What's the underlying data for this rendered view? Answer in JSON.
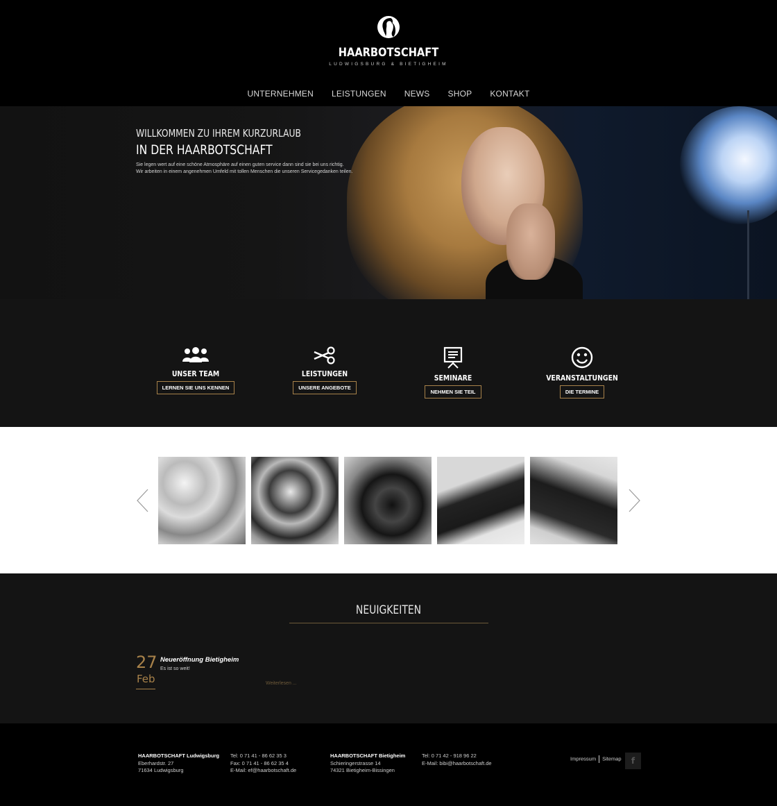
{
  "header": {
    "brand": "HAARBOTSCHAFT",
    "tagline": "LUDWIGSBURG & BIETIGHEIM",
    "nav": [
      "UNTERNEHMEN",
      "LEISTUNGEN",
      "NEWS",
      "SHOP",
      "KONTAKT"
    ]
  },
  "hero": {
    "line1": "WILLKOMMEN ZU IHREM KURZURLAUB",
    "line2": "IN DER HAARBOTSCHAFT",
    "text1": "Sie legen wert auf eine schöne Atmosphäre auf einen guten service dann sind sie bei uns richtig.",
    "text2": "Wir arbeiten in einem angenehmen Umfeld mit tollen Menschen die unseren Servicegedanken teilen.",
    "slides_total": 2,
    "active_slide": 1
  },
  "features": [
    {
      "icon": "team-icon",
      "title": "UNSER TEAM",
      "button": "LERNEN SIE UNS KENNEN"
    },
    {
      "icon": "scissors-icon",
      "title": "LEISTUNGEN",
      "button": "UNSERE ANGEBOTE"
    },
    {
      "icon": "presentation-board-icon",
      "title": "SEMINARE",
      "button": "NEHMEN SIE TEIL"
    },
    {
      "icon": "smiley-icon",
      "title": "VERANSTALTUNGEN",
      "button": "DIE TERMINE"
    }
  ],
  "gallery": {
    "images": [
      "hairstyle-photo-1",
      "hairstyle-photo-2",
      "hairstyle-photo-3",
      "hairstyle-photo-4",
      "hairstyle-photo-5"
    ],
    "prev_icon": "chevron-left-icon",
    "next_icon": "chevron-right-icon"
  },
  "news": {
    "title": "NEUIGKEITEN",
    "items": [
      {
        "day": "27",
        "month": "Feb",
        "headline": "Neueröffnung Bietigheim",
        "text": "Es ist so weit!",
        "more": "Weiterlesen ..."
      }
    ]
  },
  "footer": {
    "ludwigsburg": {
      "name": "HAARBOTSCHAFT Ludwigsburg",
      "street": "Eberhardstr. 27",
      "city": "71634 Ludwigsburg"
    },
    "ludwigsburg_contact": {
      "tel": "Tel: 0 71 41 - 86 62 35 3",
      "fax": "Fax: 0 71 41 - 86 62 35 4",
      "email": "E-Mail: ef@haarbotschaft.de"
    },
    "bietigheim": {
      "name": "HAARBOTSCHAFT Bietigheim",
      "street": "Schieringerstrasse 14",
      "city": "74321 Bietigheim-Bissingen"
    },
    "bietigheim_contact": {
      "tel": "Tel: 0 71 42 - 918 96 22",
      "email": "E-Mail: bibi@haarbotschaft.de"
    },
    "links": [
      "Impressum",
      "Sitemap"
    ],
    "social": "f"
  },
  "colors": {
    "accent": "#a8824a",
    "dark": "#141414",
    "black": "#000000"
  }
}
